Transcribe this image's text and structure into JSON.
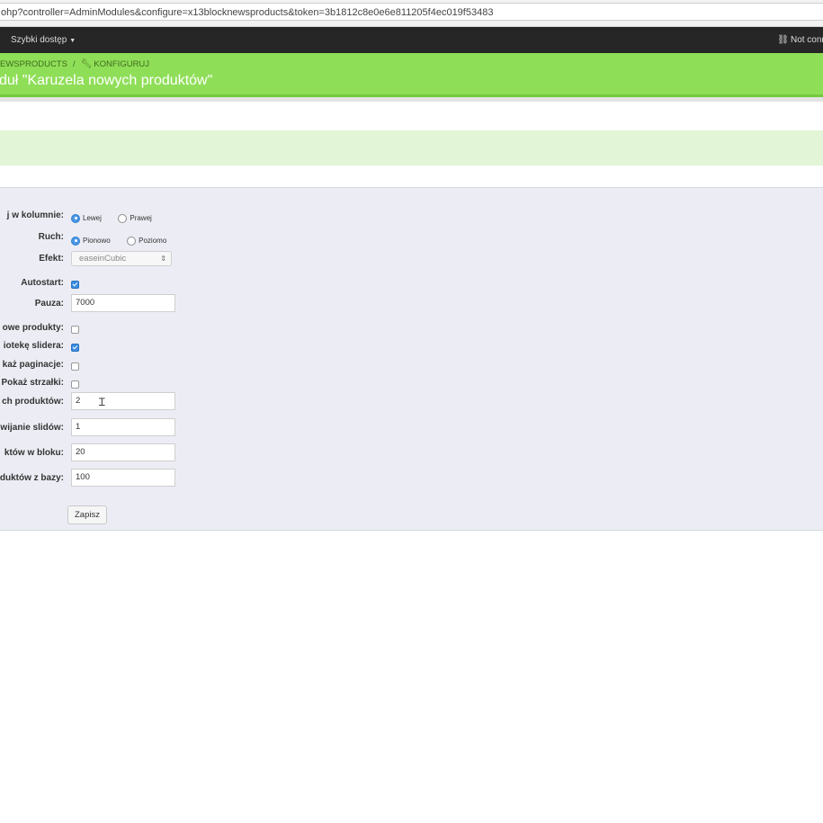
{
  "browser": {
    "url": "ohp?controller=AdminModules&configure=x13blocknewsproducts&token=3b1812c8e0e6e811205f4ec019f53483"
  },
  "topnav": {
    "quick_access": "Szybki dostęp",
    "status": "Not conn"
  },
  "header": {
    "breadcrumb_module": "EWSPRODUCTS",
    "breadcrumb_separator": "/",
    "breadcrumb_action": "KONFIGURUJ",
    "title": "duł \"Karuzela nowych produktów\""
  },
  "form": {
    "column": {
      "label": "j w kolumnie:",
      "option1": "Lewej",
      "option2": "Prawej",
      "selected": "Lewej"
    },
    "movement": {
      "label": "Ruch:",
      "option1": "Pionowo",
      "option2": "Poziomo",
      "selected": "Pionowo"
    },
    "effect": {
      "label": "Efekt:",
      "value": "easeinCubic"
    },
    "autostart": {
      "label": "Autostart:",
      "checked": true
    },
    "pause": {
      "label": "Pauza:",
      "value": "7000"
    },
    "new_products": {
      "label": "owe produkty:",
      "checked": false
    },
    "slider_library": {
      "label": "iotekę slidera:",
      "checked": true
    },
    "pagination": {
      "label": "każ paginacje:",
      "checked": false
    },
    "arrows": {
      "label": "Pokaż strzałki:",
      "checked": false
    },
    "visible_products": {
      "label": "ch produktów:",
      "value": "2"
    },
    "scroll_slides": {
      "label": "wijanie slidów:",
      "value": "1"
    },
    "block_products": {
      "label": "któw w bloku:",
      "value": "20"
    },
    "db_products": {
      "label": "duktów z bazy:",
      "value": "100"
    },
    "save_label": "Zapisz"
  }
}
